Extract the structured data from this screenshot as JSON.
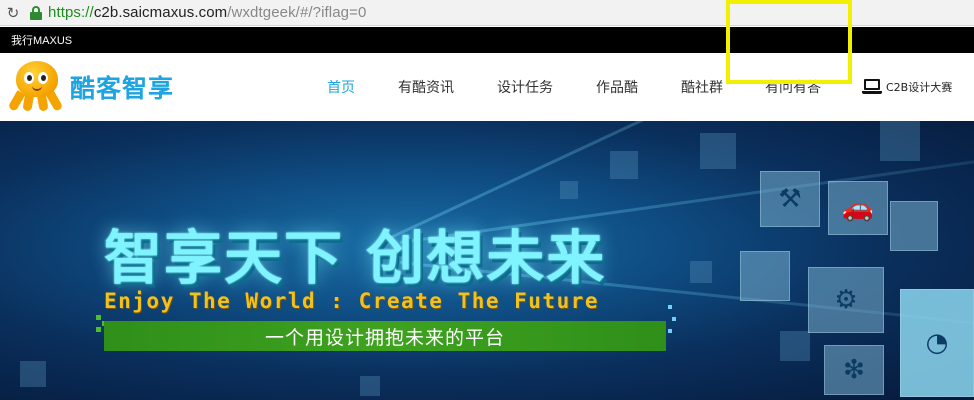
{
  "browser": {
    "url_scheme": "https://",
    "url_host": "c2b.saicmaxus.com",
    "url_path": "/wxdtgeek/#/?iflag=0"
  },
  "topbar": {
    "link_label": "我行MAXUS"
  },
  "header": {
    "logo_text": "酷客智享",
    "nav": [
      {
        "label": "首页",
        "active": true
      },
      {
        "label": "有酷资讯"
      },
      {
        "label": "设计任务"
      },
      {
        "label": "作品酷"
      },
      {
        "label": "酷社群"
      },
      {
        "label": "有问有答"
      }
    ],
    "c2b_label": "C2B设计大赛"
  },
  "banner": {
    "headline": "智享天下 创想未来",
    "subheadline": "Enjoy The World : Create The Future",
    "slogan": "一个用设计拥抱未来的平台"
  },
  "colors": {
    "accent": "#1ea4e0",
    "highlight_box": "#f0f000",
    "slogan_bar": "#3fa21f",
    "subheadline": "#f3c11d"
  }
}
